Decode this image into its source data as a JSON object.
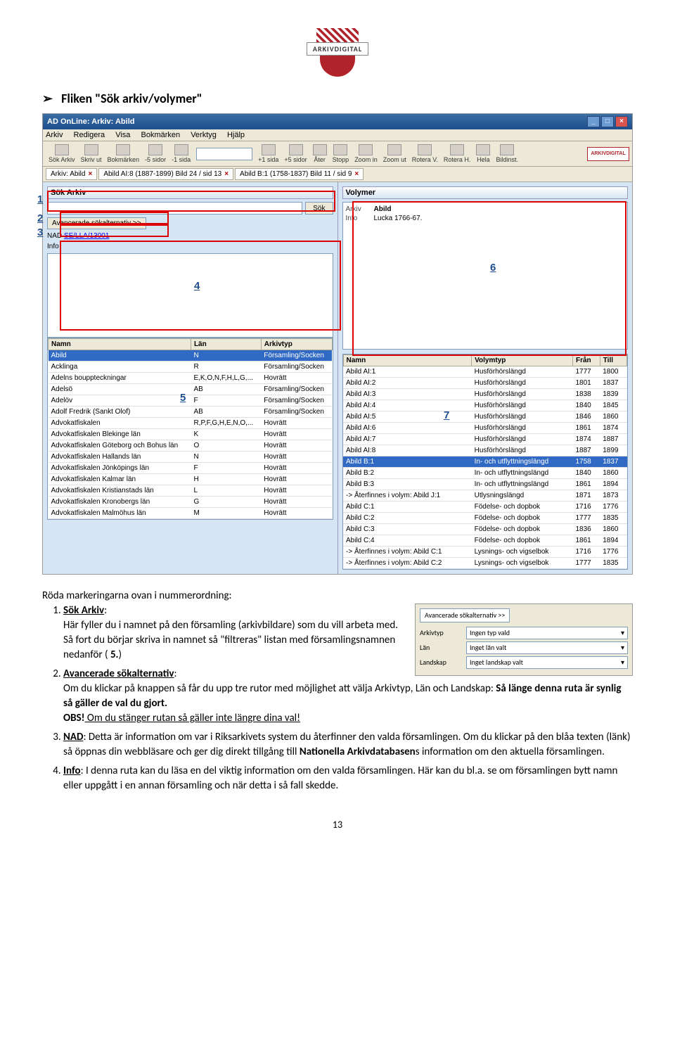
{
  "logo_text": "ARKIVDIGITAL",
  "heading_arrow": "➢",
  "heading_text": "Fliken \"Sök arkiv/volymer\"",
  "screenshot": {
    "title": "AD OnLine: Arkiv: Abild",
    "menu": [
      "Arkiv",
      "Redigera",
      "Visa",
      "Bokmärken",
      "Verktyg",
      "Hjälp"
    ],
    "toolbar": [
      "Sök Arkiv",
      "Skriv ut",
      "Bokmärken",
      "-5 sidor",
      "-1 sida",
      "+1 sida",
      "+5 sidor",
      "Åter",
      "Stopp",
      "Zoom in",
      "Zoom ut",
      "Rotera V.",
      "Rotera H.",
      "Hela",
      "Bildinst."
    ],
    "tabs": [
      "Arkiv: Abild",
      "Abild AI:8 (1887-1899) Bild 24 / sid 13",
      "Abild B:1 (1758-1837) Bild 11 / sid 9"
    ],
    "left": {
      "header": "Sök Arkiv",
      "sok_btn": "Sök",
      "adv_btn": "Avancerade sökalternativ >>",
      "nad_label": "NAD",
      "nad_link": "SE/LLA/13001",
      "info_label": "Info",
      "table_head": [
        "Namn",
        "Län",
        "Arkivtyp"
      ],
      "rows": [
        {
          "n": "Abild",
          "l": "N",
          "a": "Församling/Socken",
          "sel": true
        },
        {
          "n": "Acklinga",
          "l": "R",
          "a": "Församling/Socken"
        },
        {
          "n": "Adelns bouppteckningar",
          "l": "E,K,O,N,F,H,L,G,...",
          "a": "Hovrätt"
        },
        {
          "n": "Adelsö",
          "l": "AB",
          "a": "Församling/Socken"
        },
        {
          "n": "Adelöv",
          "l": "F",
          "a": "Församling/Socken"
        },
        {
          "n": "Adolf Fredrik (Sankt Olof)",
          "l": "AB",
          "a": "Församling/Socken"
        },
        {
          "n": "Advokatfiskalen",
          "l": "R,P,F,G,H,E,N,O,...",
          "a": "Hovrätt"
        },
        {
          "n": "Advokatfiskalen Blekinge län",
          "l": "K",
          "a": "Hovrätt"
        },
        {
          "n": "Advokatfiskalen Göteborg och Bohus län",
          "l": "O",
          "a": "Hovrätt"
        },
        {
          "n": "Advokatfiskalen Hallands län",
          "l": "N",
          "a": "Hovrätt"
        },
        {
          "n": "Advokatfiskalen Jönköpings län",
          "l": "F",
          "a": "Hovrätt"
        },
        {
          "n": "Advokatfiskalen Kalmar län",
          "l": "H",
          "a": "Hovrätt"
        },
        {
          "n": "Advokatfiskalen Kristianstads län",
          "l": "L",
          "a": "Hovrätt"
        },
        {
          "n": "Advokatfiskalen Kronobergs län",
          "l": "G",
          "a": "Hovrätt"
        },
        {
          "n": "Advokatfiskalen Malmöhus län",
          "l": "M",
          "a": "Hovrätt"
        }
      ]
    },
    "right": {
      "header": "Volymer",
      "arkiv_k": "Arkiv",
      "arkiv_v": "Abild",
      "info_k": "Info",
      "info_v": "Lucka 1766-67.",
      "table_head": [
        "Namn",
        "Volymtyp",
        "Från",
        "Till"
      ],
      "rows": [
        {
          "n": "Abild AI:1",
          "v": "Husförhörslängd",
          "f": "1777",
          "t": "1800"
        },
        {
          "n": "Abild AI:2",
          "v": "Husförhörslängd",
          "f": "1801",
          "t": "1837"
        },
        {
          "n": "Abild AI:3",
          "v": "Husförhörslängd",
          "f": "1838",
          "t": "1839"
        },
        {
          "n": "Abild AI:4",
          "v": "Husförhörslängd",
          "f": "1840",
          "t": "1845"
        },
        {
          "n": "Abild AI:5",
          "v": "Husförhörslängd",
          "f": "1846",
          "t": "1860"
        },
        {
          "n": "Abild AI:6",
          "v": "Husförhörslängd",
          "f": "1861",
          "t": "1874"
        },
        {
          "n": "Abild AI:7",
          "v": "Husförhörslängd",
          "f": "1874",
          "t": "1887"
        },
        {
          "n": "Abild AI:8",
          "v": "Husförhörslängd",
          "f": "1887",
          "t": "1899"
        },
        {
          "n": "Abild B:1",
          "v": "In- och utflyttningslängd",
          "f": "1758",
          "t": "1837",
          "sel": true
        },
        {
          "n": "Abild B:2",
          "v": "In- och utflyttningslängd",
          "f": "1840",
          "t": "1860"
        },
        {
          "n": "Abild B:3",
          "v": "In- och utflyttningslängd",
          "f": "1861",
          "t": "1894"
        },
        {
          "n": "-> Återfinnes i volym: Abild J:1",
          "v": "Utlysningslängd",
          "f": "1871",
          "t": "1873"
        },
        {
          "n": "Abild C:1",
          "v": "Födelse- och dopbok",
          "f": "1716",
          "t": "1776"
        },
        {
          "n": "Abild C:2",
          "v": "Födelse- och dopbok",
          "f": "1777",
          "t": "1835"
        },
        {
          "n": "Abild C:3",
          "v": "Födelse- och dopbok",
          "f": "1836",
          "t": "1860"
        },
        {
          "n": "Abild C:4",
          "v": "Födelse- och dopbok",
          "f": "1861",
          "t": "1894"
        },
        {
          "n": "-> Återfinnes i volym: Abild C:1",
          "v": "Lysnings- och vigselbok",
          "f": "1716",
          "t": "1776"
        },
        {
          "n": "-> Återfinnes i volym: Abild C:2",
          "v": "Lysnings- och vigselbok",
          "f": "1777",
          "t": "1835"
        }
      ]
    }
  },
  "caption": "Röda markeringarna ovan i nummerordning:",
  "inset": {
    "adv": "Avancerade sökalternativ >>",
    "rows": [
      {
        "l": "Arkivtyp",
        "v": "Ingen typ vald"
      },
      {
        "l": "Län",
        "v": "Inget län valt"
      },
      {
        "l": "Landskap",
        "v": "Inget landskap valt"
      }
    ]
  },
  "list": {
    "i1_title": "Sök Arkiv",
    "i1_a": ": ",
    "i1_b": "Här fyller du i namnet på den församling (arkivbildare) som du vill arbeta med. Så fort du börjar skriva in namnet så \"filtreras\" listan med församlingsnamnen nedanför ( ",
    "i1_c": "5.",
    "i1_d": ")",
    "i2_title": "Avancerade sökalternativ",
    "i2_a": ": ",
    "i2_b": "Om du klickar på knappen så får du upp tre rutor med möjlighet att välja Arkivtyp, Län och Landskap: ",
    "i2_c": "Så länge denna ruta är synlig så gäller de val du gjort.",
    "i2_obs": "OBS!",
    "i2_d": " Om du stänger rutan så gäller inte längre dina val!",
    "i3_title": "NAD",
    "i3_a": ": Detta är information om var i Riksarkivets system du återfinner den valda församlingen. Om du klickar på den blåa texten (länk) så öppnas din webbläsare och ger dig direkt tillgång till ",
    "i3_b": "Nationella Arkivdatabasen",
    "i3_c": "s information om den aktuella församlingen.",
    "i4_title": "Info",
    "i4_a": ": I denna ruta kan du läsa en del viktig information om den valda församlingen. Här kan du bl.a. se om församlingen bytt namn eller uppgått i en annan församling och när detta i så fall skedde."
  },
  "markers": {
    "m1": "1",
    "m2": "2",
    "m3": "3",
    "m4": "4",
    "m5": "5",
    "m6": "6",
    "m7": "7"
  },
  "pagenum": "13"
}
